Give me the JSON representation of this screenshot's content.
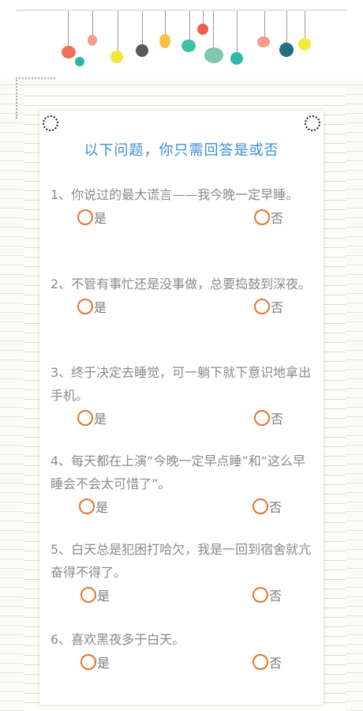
{
  "title": "以下问题，你只需回答是或否",
  "questions": [
    {
      "text": "1、你说过的最大谎言——我今晚一定早睡。",
      "yes": "是",
      "no": "否"
    },
    {
      "text": "2、不管有事忙还是没事做，总要捣鼓到深夜。",
      "yes": "是",
      "no": "否"
    },
    {
      "text": "3、终于决定去睡觉，可一躺下就下意识地拿出手机。",
      "yes": "是",
      "no": "否"
    },
    {
      "text": "4、每天都在上演“今晚一定早点睡”和“这么早睡会不会太可惜了”。",
      "yes": "是",
      "no": "否"
    },
    {
      "text": "5、白天总是犯困打哈欠，我是一回到宿舍就亢奋得不得了。",
      "yes": "是",
      "no": "否"
    },
    {
      "text": "6、喜欢黑夜多于白天。",
      "yes": "是",
      "no": "否"
    }
  ],
  "colors": {
    "title": "#3b8fd6",
    "radio": "#e8742a",
    "text": "#8a8a8a"
  }
}
